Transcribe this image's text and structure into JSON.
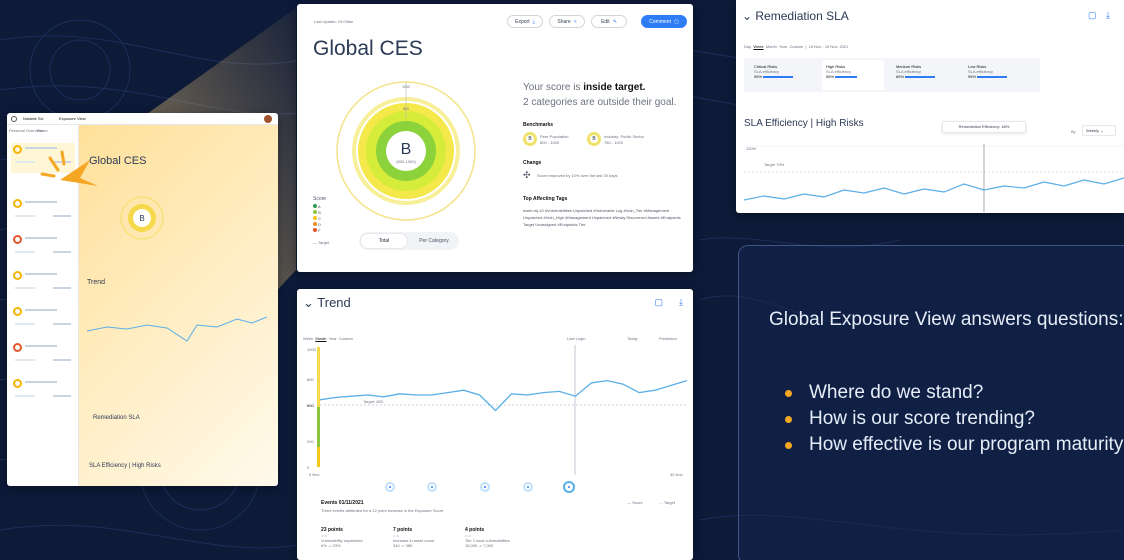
{
  "background": {
    "color": "#0d1a38",
    "accent": "#f5a623"
  },
  "thumbnail": {
    "app_name": "Notable Six",
    "view_title": "Exposure View",
    "tabs": [
      "Personal Overview",
      "Share"
    ],
    "card_title": "Global CES",
    "section_trend": "Trend",
    "section_sla": "Remediation SLA",
    "section_sla_eff": "SLA Efficiency | High Risks",
    "grade": "B"
  },
  "ces": {
    "last_update": "Last Update: 10:03am",
    "title": "Global CES",
    "actions": {
      "export": "Export",
      "share": "Share",
      "edit": "Edit",
      "comment": "Comment"
    },
    "gauge": {
      "grade": "B",
      "score_range": "(800-1000)",
      "outer_label": "1000",
      "mid_label": "800"
    },
    "score_text_pre": "Your score is ",
    "score_text_emph": "inside target.",
    "score_text_line2": "2 categories are outside their goal.",
    "benchmarks_title": "Benchmarks",
    "benchmark_1": {
      "grade": "B",
      "title": "Peer Population",
      "sub": "800 - 1000"
    },
    "benchmark_2": {
      "grade": "B",
      "title": "Industry: Public Sector",
      "sub": "780 - 1020"
    },
    "change_title": "Change",
    "change_text": "Score improved by 10% over the last 30 days",
    "tags_title": "Top Affecting Tags",
    "tags": [
      "#web-inj-10",
      "#Vulnerabilities Unpatched",
      "#Vulnerable Log",
      "#Vuln_Tier",
      "#Management Unpatched",
      "#Vuln_High",
      "#Management Unpatched",
      "#Newly Discovered Assets",
      "#Endpoints Target Unassigned",
      "#Endpoints Tier"
    ],
    "legend_title": "Score",
    "legend_items": [
      "A",
      "B",
      "C",
      "D",
      "F"
    ],
    "legend_colors": [
      "#2e9e4f",
      "#8cc63f",
      "#f5c518",
      "#f08c2a",
      "#e4572e"
    ],
    "target_label": "Target",
    "toggle": {
      "total": "Total",
      "per_category": "Per Category"
    }
  },
  "trend": {
    "title": "Trend",
    "range_options": [
      "Week",
      "Month",
      "Year",
      "Custom"
    ],
    "active_range": "Month",
    "markers": {
      "last_login": "Last Login",
      "today": "Today",
      "prediction": "Prediction"
    },
    "y_ticks": [
      "1000",
      "800",
      "600",
      "200",
      "0"
    ],
    "target_label": "Target: 800",
    "x_start": "5 Nov",
    "x_end": "30 Nov",
    "events_title": "Events 01/11/2021",
    "events_sub": "Three events attributed for a 12 point increase in the Exposure Score",
    "legend": {
      "score": "Score",
      "target": "Target"
    },
    "events": [
      {
        "points": "23 points",
        "desc": "Vulnerability unpatched",
        "range": "6% -> 23%"
      },
      {
        "points": "7 points",
        "desc": "Increase in asset count",
        "range": "340 -> 380"
      },
      {
        "points": "4 points",
        "desc": "Tier 1 local vulnerabilities",
        "range": "15,000 -> 7,000"
      }
    ],
    "chart_data": {
      "type": "line",
      "series": [
        {
          "name": "Score",
          "values": [
            560,
            580,
            590,
            600,
            585,
            610,
            600,
            600,
            620,
            640,
            600,
            470,
            610,
            600,
            620,
            630,
            590,
            700,
            720,
            690,
            620,
            640,
            680,
            720
          ]
        },
        {
          "name": "Target",
          "values": [
            800,
            800,
            800,
            800,
            800,
            800,
            800,
            800,
            800,
            800,
            800,
            800,
            800,
            800,
            800,
            800,
            800,
            800,
            800,
            800,
            800,
            800,
            800,
            800
          ]
        }
      ]
    }
  },
  "sla": {
    "title": "Remediation SLA",
    "filters": [
      "Day",
      "Week",
      "Month",
      "Year",
      "Custom"
    ],
    "active_filter": "Week",
    "date_range": "15 Nov - 15 Nov, 2021",
    "cols": [
      {
        "title": "Critical Risks",
        "sub": "SLA efficiency",
        "value": "95%"
      },
      {
        "title": "High Risks",
        "sub": "SLA efficiency",
        "value": "58%"
      },
      {
        "title": "Medium Risks",
        "sub": "SLA efficiency",
        "value": "85%"
      },
      {
        "title": "Low Risks",
        "sub": "SLA efficiency",
        "value": "95%"
      }
    ],
    "efficiency_title": "SLA Efficiency  |  High Risks",
    "tooltip": "Remediation Efficiency: 48%",
    "by_label": "By",
    "by_value": "Weekly",
    "y_top": "100%",
    "target_label": "Target 70%"
  },
  "info": {
    "intro": "Global Exposure View answers questions:",
    "bullets": [
      "Where do we stand?",
      "How is our score trending?",
      "How effective is our program maturity?"
    ]
  }
}
